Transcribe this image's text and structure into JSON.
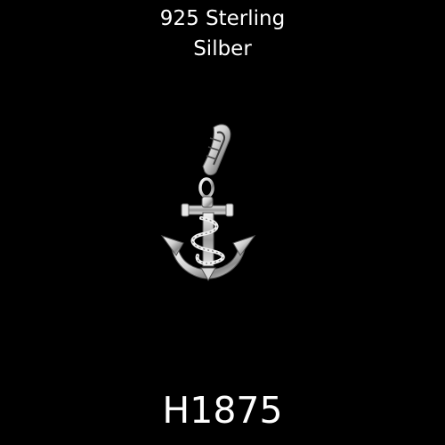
{
  "caption": {
    "line1": "925 Sterling",
    "line2": "Silber",
    "product_code": "H1875"
  },
  "colors": {
    "background": "#000000",
    "text": "#ffffff",
    "silver_light": "#f2f2f2",
    "silver_mid": "#bdbdbd",
    "silver_dark": "#6f6f6f"
  },
  "image": {
    "subject": "anchor-charm-icon"
  }
}
